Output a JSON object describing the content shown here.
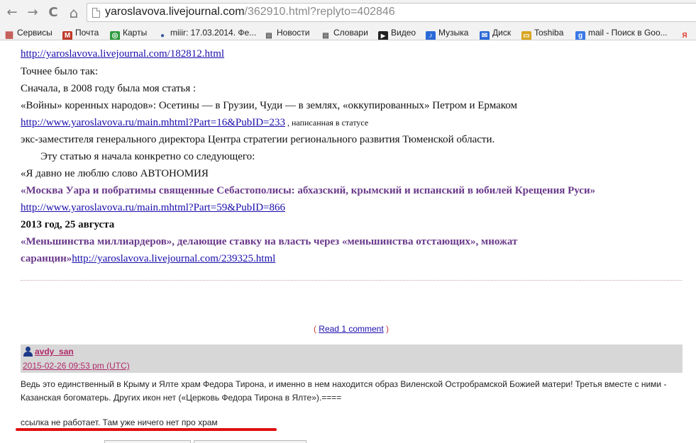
{
  "browser": {
    "back_glyph": "←",
    "forward_glyph": "→",
    "reload_glyph": "C",
    "home_glyph": "⌂",
    "url_host": "yaroslavova.livejournal.com",
    "url_path": "/362910.html?replyto=402846"
  },
  "bookmarks": [
    {
      "label": "Сервисы",
      "icon": "apps-icon",
      "color": "#c0504d",
      "glyph": "▦"
    },
    {
      "label": "Почта",
      "icon": "mail-icon",
      "color": "#c0392b",
      "glyph": "M"
    },
    {
      "label": "Карты",
      "icon": "maps-icon",
      "color": "#2e9b3e",
      "glyph": "◎"
    },
    {
      "label": "miiir: 17.03.2014. Фе...",
      "icon": "user-icon",
      "color": "#3b5998",
      "glyph": "●"
    },
    {
      "label": "Новости",
      "icon": "page-icon",
      "color": "#777777",
      "glyph": "▤"
    },
    {
      "label": "Словари",
      "icon": "page-icon",
      "color": "#777777",
      "glyph": "▤"
    },
    {
      "label": "Видео",
      "icon": "video-icon",
      "color": "#222222",
      "glyph": "▶"
    },
    {
      "label": "Музыка",
      "icon": "music-icon",
      "color": "#2a6ad8",
      "glyph": "♪"
    },
    {
      "label": "Диск",
      "icon": "disk-icon",
      "color": "#2a6ad8",
      "glyph": "✉"
    },
    {
      "label": "Toshiba",
      "icon": "folder-icon",
      "color": "#d9a521",
      "glyph": "▭"
    },
    {
      "label": "mail - Поиск в Goo...",
      "icon": "google-icon",
      "color": "#3b78e7",
      "glyph": "g"
    },
    {
      "label": "Я",
      "icon": "yandex-icon",
      "color": "#e23d2d",
      "glyph": "Я"
    }
  ],
  "post": {
    "link1": "http://yaroslavova.livejournal.com/182812.html",
    "line_tochnee": "Точнее  было так:",
    "line_snachala": "Сначала,  в  2008   году   была  моя статья :",
    "line_voiny": "«Войны» коренных народов»: Осетины — в Грузии, Чуди — в землях, «оккупированных» Петром и Ермаком",
    "link2": "http://www.yaroslavova.ru/main.mhtml?Part=16&PubID=233",
    "link2_note": " , написанная  в   статусе",
    "line_eks": "экс-заместителя  генерального директора  Центра  стратегии  регионального  развития  Тюменской  области.",
    "line_etu": "Эту  статью я  начала  конкретно со следующего:",
    "line_avtonomia": "«Я давно не люблю слово АВТОНОМИЯ",
    "line_moskva": "«Москва Уара и побратимы священные Себастополисы: абхазский, крымский и испанский в юбилей Крещения Руси»",
    "link3": "http://www.yaroslavova.ru/main.mhtml?Part=59&PubID=866",
    "line_2013": "2013 год,  25 августа",
    "line_menshinstva": "«Меньшинства миллиардеров», делающие ставку на власть через «меньшинства отстающих», множат",
    "line_sarancin": "саранцин»",
    "link4": "http://yaroslavova.livejournal.com/239325.html"
  },
  "comments_link": {
    "open": "( ",
    "label": "Read 1 comment",
    "close": " )"
  },
  "comment": {
    "username": "avdy_san",
    "timestamp": "2015-02-26 09:53 pm (UTC)",
    "text": "Ведь это единственный в Крыму и Ялте храм Федора Тирона, и именно в нем находится образ Виленской Остробрамской Божией матери! Третья вместе с ними - Казанская богоматерь. Других икон нет («Церковь Федора Тирона в Ялте»).====",
    "note": "ссылка не работает. Там уже ничего нет про храм"
  }
}
